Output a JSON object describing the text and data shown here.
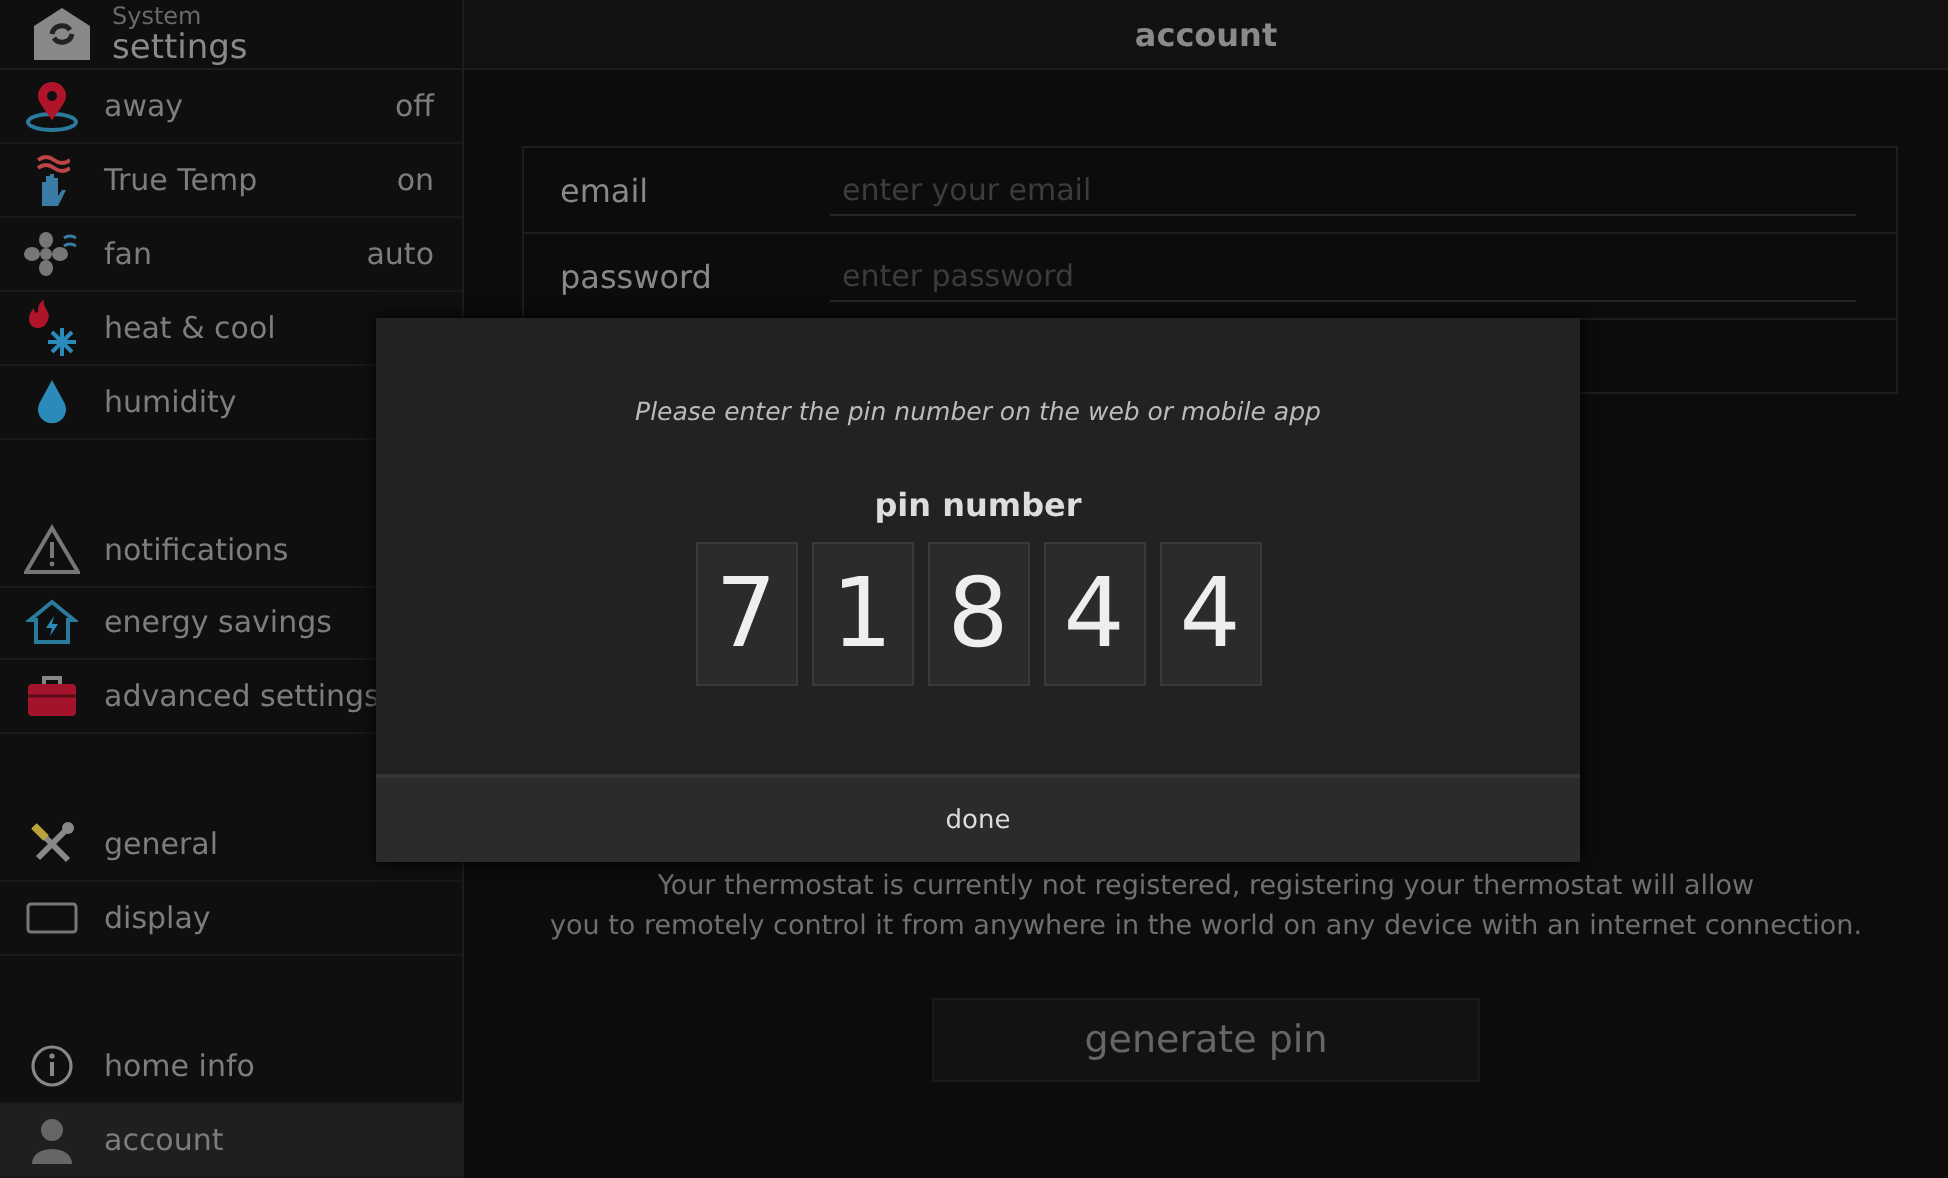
{
  "sidebar": {
    "header": {
      "line1": "System",
      "line2": "settings"
    },
    "groups": [
      [
        {
          "label": "away",
          "value": "off",
          "selected": false
        },
        {
          "label": "True Temp",
          "value": "on",
          "selected": false
        },
        {
          "label": "fan",
          "value": "auto",
          "selected": false
        },
        {
          "label": "heat & cool",
          "selected": false
        },
        {
          "label": "humidity",
          "selected": false
        }
      ],
      [
        {
          "label": "notifications",
          "selected": false
        },
        {
          "label": "energy savings",
          "selected": false
        },
        {
          "label": "advanced settings",
          "selected": false
        }
      ],
      [
        {
          "label": "general",
          "selected": false
        },
        {
          "label": "display",
          "selected": false
        }
      ],
      [
        {
          "label": "home info",
          "selected": false
        },
        {
          "label": "account",
          "selected": true
        }
      ]
    ]
  },
  "main": {
    "title": "account",
    "fields": [
      {
        "label": "email",
        "placeholder": "enter your email"
      },
      {
        "label": "password",
        "placeholder": "enter password"
      }
    ],
    "description": [
      "Your thermostat is currently not registered, registering your thermostat will allow",
      "you to remotely control it from anywhere in  the world on any device with an internet connection."
    ],
    "button": "generate pin"
  },
  "dialog": {
    "message": "Please enter the pin number on the web or mobile app",
    "pin_label": "pin number",
    "digits": [
      "7",
      "1",
      "8",
      "4",
      "4"
    ],
    "button": "done"
  }
}
